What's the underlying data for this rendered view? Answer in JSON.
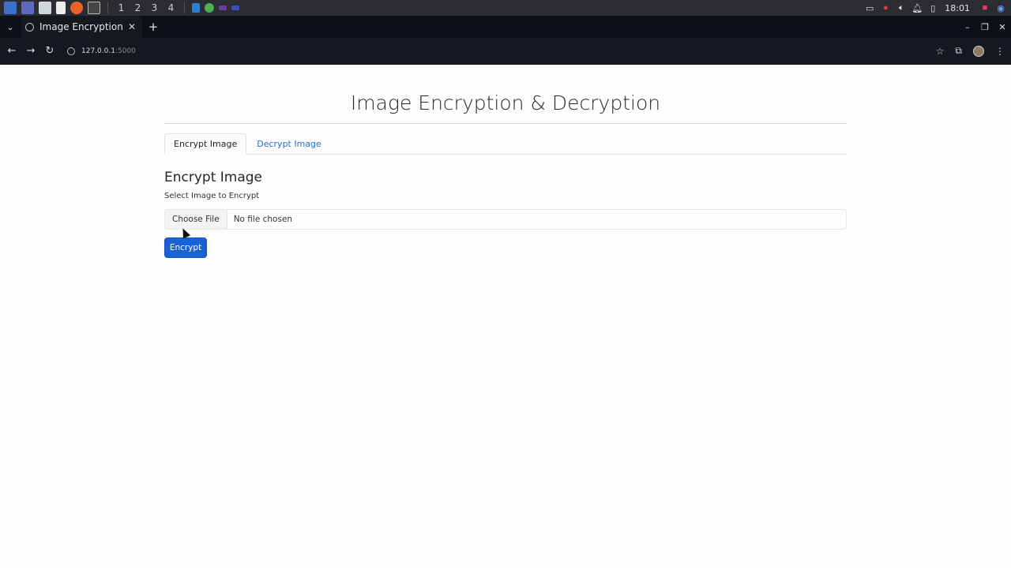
{
  "taskbar": {
    "workspaces": [
      "1",
      "2",
      "3",
      "4"
    ],
    "clock": "18:01",
    "apps": [
      {
        "icon": "app-menu-icon",
        "color": "#3d6fcf"
      },
      {
        "icon": "files-icon",
        "color": "#5c6bc0"
      },
      {
        "icon": "folder-icon",
        "color": "#cfd8dc"
      },
      {
        "icon": "document-icon",
        "color": "#eeeeee"
      },
      {
        "icon": "firefox-icon",
        "color": "#e8622a"
      },
      {
        "icon": "terminal-icon",
        "color": "#444444"
      }
    ],
    "pinned": [
      {
        "icon": "vscode-icon",
        "color": "#2f7fd1"
      },
      {
        "icon": "chrome-icon",
        "color": "#4caf50"
      },
      {
        "icon": "app-icon",
        "color": "#6b3fa0"
      },
      {
        "icon": "app-icon-2",
        "color": "#3f51b5"
      }
    ]
  },
  "browser": {
    "tab_title": "Image Encryption &",
    "url_host": "127.0.0.1",
    "url_port": ":5000"
  },
  "page": {
    "heading": "Image Encryption & Decryption",
    "tabs": [
      {
        "label": "Encrypt Image",
        "active": true
      },
      {
        "label": "Decrypt Image",
        "active": false
      }
    ],
    "section_title": "Encrypt Image",
    "file_label": "Select Image to Encrypt",
    "file_button": "Choose File",
    "file_status": "No file chosen",
    "submit_label": "Encrypt"
  },
  "colors": {
    "accent": "#1a62d4",
    "link": "#2a6fc9",
    "taskbar": "#2b2d33",
    "browser_chrome": "#15181e"
  }
}
